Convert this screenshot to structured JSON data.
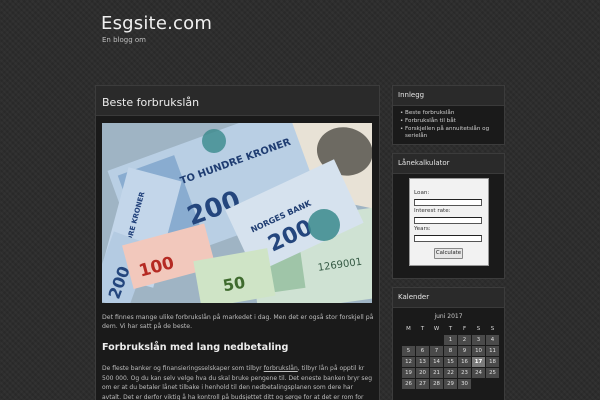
{
  "site": {
    "title": "Esgsite.com",
    "description": "En blogg om"
  },
  "post": {
    "title": "Beste forbrukslån",
    "intro": "Det finnes mange ulike forbrukslån på markedet i dag. Men det er også stor forskjell på dem. Vi har satt på de beste.",
    "heading": "Forbrukslån med lang nedbetaling",
    "body_pre": "De fleste banker og finansieringsselskaper som tilbyr ",
    "body_link": "forbrukslån",
    "body_post": ", tilbyr lån på opptil kr 500 000. Og du kan selv velge hva du skal bruke pengene til. Det eneste banken bryr seg om er at du betaler lånet tilbake i henhold til den nedbetalingsplanen som dere har avtalt. Det er derfor viktig å ha kontroll på budsjettet ditt og sørge for at det er rom for nedbetaling av",
    "image": {
      "notes": [
        {
          "label": "TO HUNDRE KRONER"
        },
        {
          "label": "200"
        },
        {
          "label": "100"
        },
        {
          "label": "50"
        },
        {
          "label": "NORGES BANK"
        }
      ]
    }
  },
  "sidebar": {
    "recent": {
      "title": "Innlegg",
      "items": [
        "Beste forbrukslån",
        "Forbrukslån til båt",
        "Forskjellen på annuitetslån og serielån"
      ]
    },
    "calculator": {
      "title": "Lånekalkulator",
      "loan_label": "Loan:",
      "rate_label": "Interest rate:",
      "years_label": "Years:",
      "button_label": "Calculate"
    },
    "calendar": {
      "title": "Kalender",
      "month": "juni 2017",
      "weekdays": [
        "M",
        "T",
        "W",
        "T",
        "F",
        "S",
        "S"
      ],
      "weeks": [
        [
          "",
          "",
          "",
          "1",
          "2",
          "3",
          "4"
        ],
        [
          "5",
          "6",
          "7",
          "8",
          "9",
          "10",
          "11"
        ],
        [
          "12",
          "13",
          "14",
          "15",
          "16",
          "17",
          "18"
        ],
        [
          "19",
          "20",
          "21",
          "22",
          "23",
          "24",
          "25"
        ],
        [
          "26",
          "27",
          "28",
          "29",
          "30",
          "",
          ""
        ]
      ],
      "today": "17"
    }
  },
  "colors": {
    "background": "#2d2d2d",
    "panel": "#1a1a1a",
    "header": "#2a2a2a",
    "today_cell": "#7a7a7a"
  }
}
